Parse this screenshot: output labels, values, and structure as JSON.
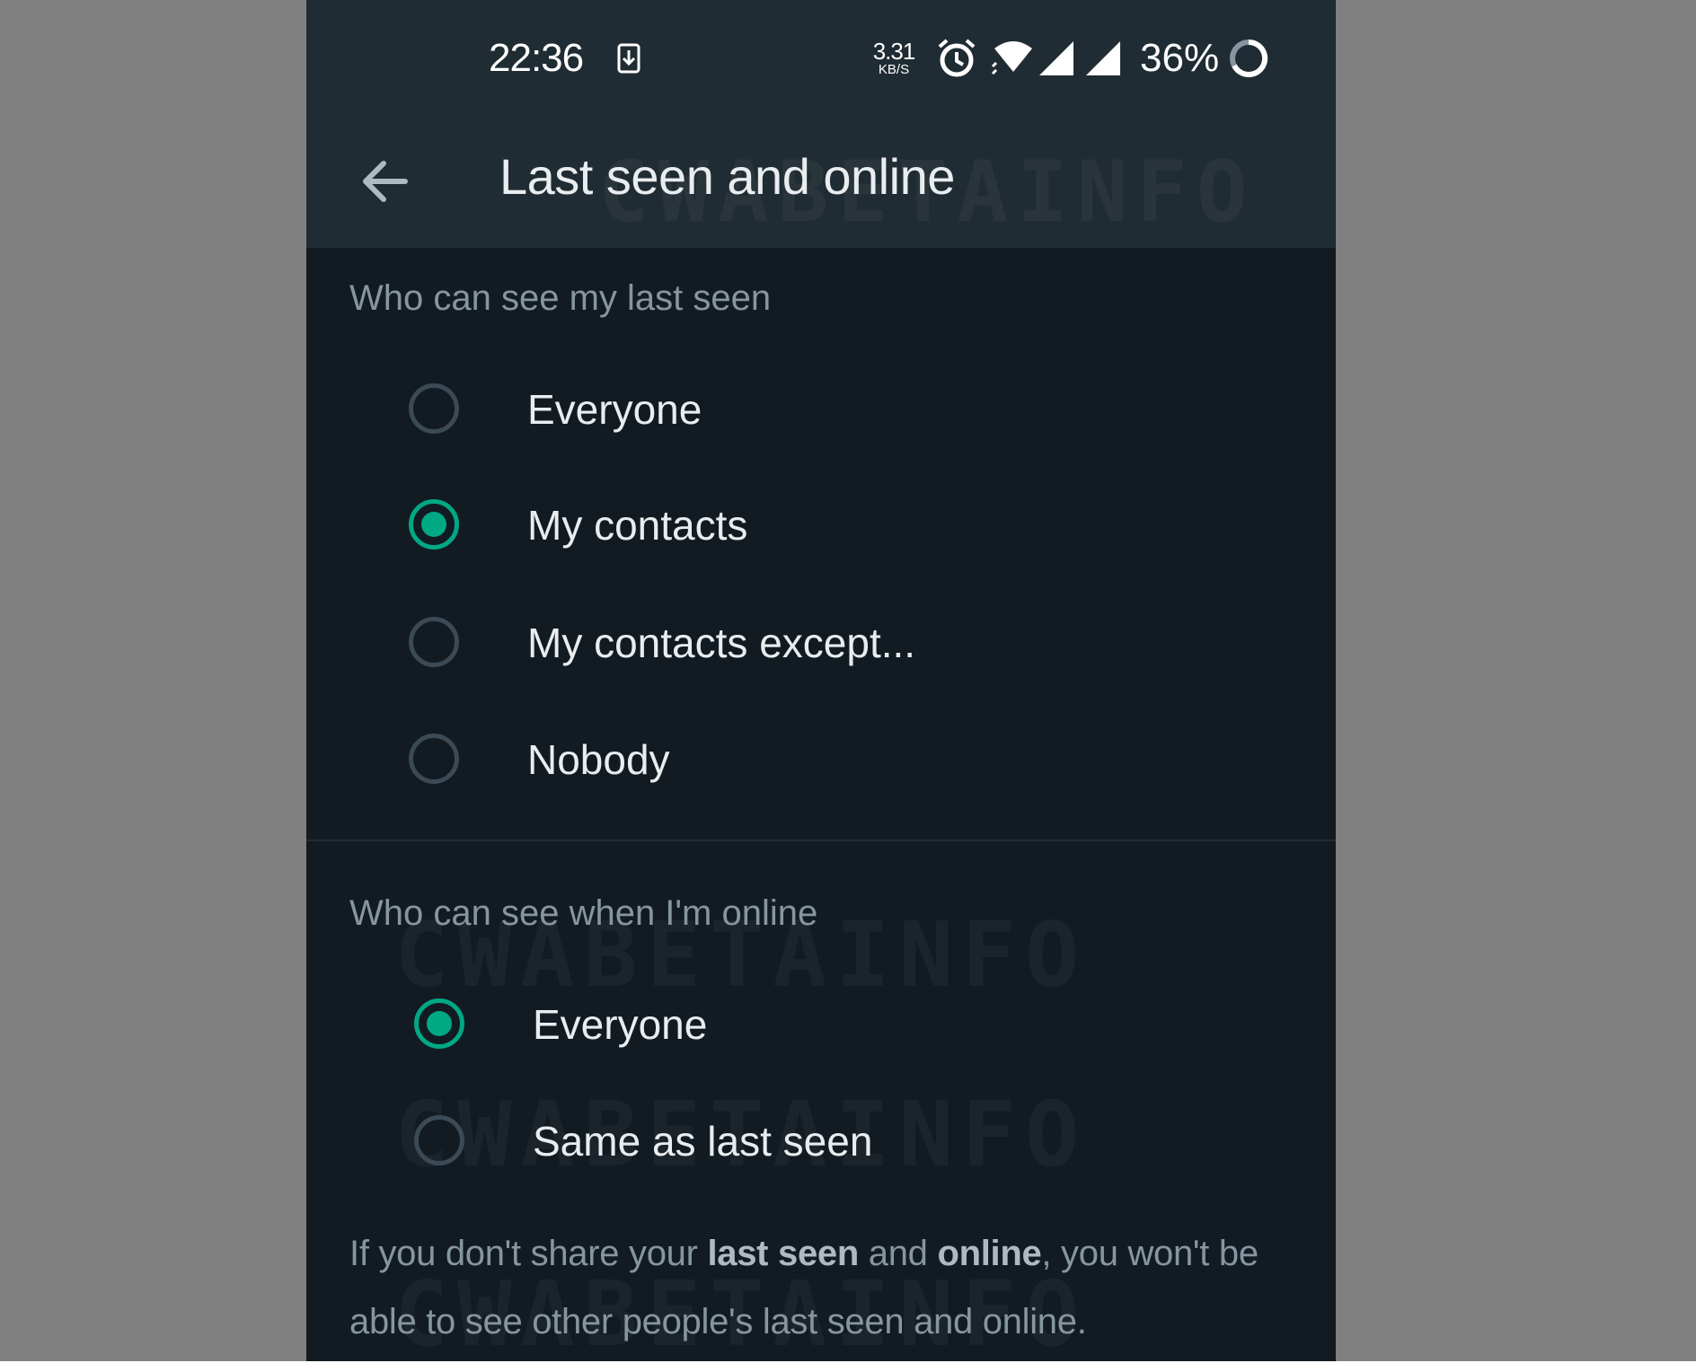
{
  "status_bar": {
    "time": "22:36",
    "net_speed_value": "3.31",
    "net_speed_unit": "KB/S",
    "battery_percent": "36%",
    "icons": [
      "download-icon",
      "alarm-icon",
      "wifi-icon",
      "signal-icon",
      "signal-icon",
      "battery-ring-icon"
    ]
  },
  "app_bar": {
    "title": "Last seen and online",
    "back_icon": "arrow-left-icon"
  },
  "watermark_text": "CWABETAINFO",
  "last_seen": {
    "header": "Who can see my last seen",
    "options": [
      {
        "label": "Everyone",
        "selected": false
      },
      {
        "label": "My contacts",
        "selected": true
      },
      {
        "label": "My contacts except...",
        "selected": false
      },
      {
        "label": "Nobody",
        "selected": false
      }
    ]
  },
  "online": {
    "header": "Who can see when I'm online",
    "options": [
      {
        "label": "Everyone",
        "selected": true
      },
      {
        "label": "Same as last seen",
        "selected": false
      }
    ]
  },
  "footer": {
    "part1": "If you don't share your ",
    "bold1": "last seen",
    "part2": " and ",
    "bold2": "online",
    "part3": ", you won't be able to see other people's last seen and online."
  },
  "colors": {
    "accent": "#00a884",
    "background": "#121b22",
    "header_bg": "#202c33",
    "secondary_text": "#8696a0",
    "primary_text": "#e9edef"
  }
}
